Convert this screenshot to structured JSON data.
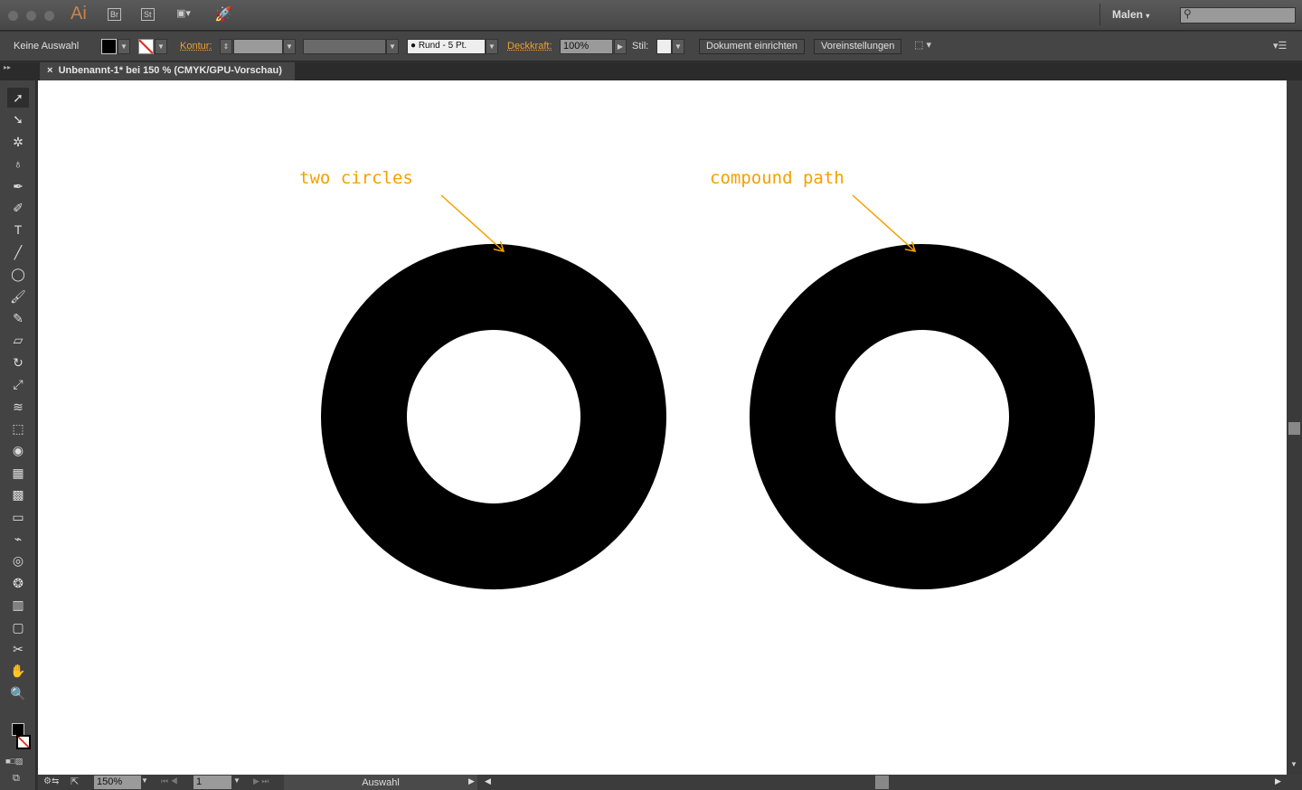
{
  "titlebar": {
    "app_logo": "Ai",
    "bridge": "Br",
    "stock": "St",
    "workspace": "Malen",
    "search_placeholder": ""
  },
  "control_bar": {
    "selection_status": "Keine Auswahl",
    "stroke_label": "Kontur:",
    "stroke_weight": "",
    "variable_width": "",
    "brush": "Rund - 5 Pt.",
    "opacity_label": "Deckkraft:",
    "opacity": "100%",
    "style_label": "Stil:",
    "document_setup": "Dokument einrichten",
    "preferences": "Voreinstellungen"
  },
  "document_tab": {
    "close": "×",
    "title": "Unbenannt-1* bei 150 % (CMYK/GPU-Vorschau)"
  },
  "tools": [
    "selection-tool",
    "direct-selection-tool",
    "magic-wand-tool",
    "lasso-tool",
    "pen-tool",
    "curvature-tool",
    "type-tool",
    "line-tool",
    "ellipse-tool",
    "paintbrush-tool",
    "pencil-tool",
    "eraser-tool",
    "rotate-tool",
    "scale-tool",
    "warp-tool",
    "free-transform-tool",
    "shape-builder-tool",
    "perspective-grid-tool",
    "mesh-tool",
    "gradient-tool",
    "eyedropper-tool",
    "blend-tool",
    "symbol-sprayer-tool",
    "graph-tool",
    "artboard-tool",
    "slice-tool",
    "hand-tool",
    "zoom-tool"
  ],
  "tool_glyphs": [
    "➚",
    "➘",
    "✲",
    "♁",
    "✒",
    "✐",
    "T",
    "╱",
    "◯",
    "🖌",
    "✎",
    "▱",
    "↻",
    "⤢",
    "≋",
    "⬚",
    "◉",
    "▦",
    "▩",
    "▭",
    "⌁",
    "◎",
    "❂",
    "▥",
    "▢",
    "✂",
    "✋",
    "🔍"
  ],
  "artwork": {
    "annotations": [
      "two circles",
      "compound path"
    ],
    "annotation_color": "#f5a000",
    "shape_color": "#000000"
  },
  "statusbar": {
    "zoom": "150%",
    "artboard": "1",
    "tool_status": "Auswahl"
  }
}
